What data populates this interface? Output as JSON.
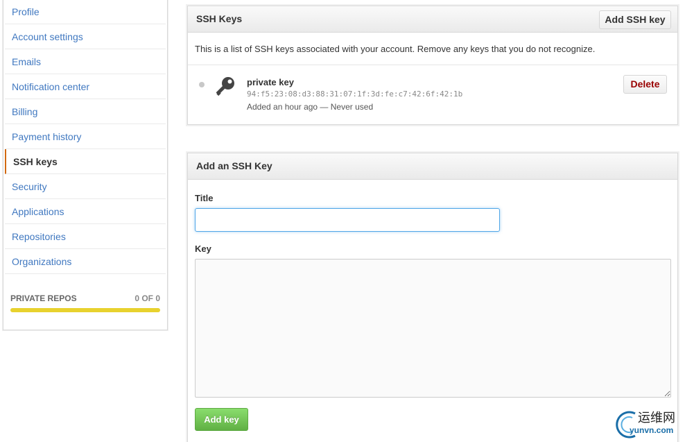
{
  "sidebar": {
    "items": [
      {
        "label": "Profile"
      },
      {
        "label": "Account settings"
      },
      {
        "label": "Emails"
      },
      {
        "label": "Notification center"
      },
      {
        "label": "Billing"
      },
      {
        "label": "Payment history"
      },
      {
        "label": "SSH keys",
        "selected": true
      },
      {
        "label": "Security"
      },
      {
        "label": "Applications"
      },
      {
        "label": "Repositories"
      },
      {
        "label": "Organizations"
      }
    ],
    "private_repos": {
      "label": "PRIVATE REPOS",
      "count": "0 OF 0",
      "progress": 1.0,
      "bar_color": "#e8d22e"
    }
  },
  "ssh_keys": {
    "title": "SSH Keys",
    "add_button": "Add SSH key",
    "notice": "This is a list of SSH keys associated with your account. Remove any keys that you do not recognize.",
    "keys": [
      {
        "name": "private key",
        "fingerprint": "94:f5:23:08:d3:88:31:07:1f:3d:fe:c7:42:6f:42:1b",
        "meta": "Added an hour ago — Never used",
        "delete_label": "Delete",
        "icon": "key-icon"
      }
    ]
  },
  "add_key": {
    "title": "Add an SSH Key",
    "title_label": "Title",
    "title_value": "",
    "key_label": "Key",
    "key_value": "",
    "submit_label": "Add key"
  },
  "watermark": {
    "cn": "运维网",
    "en": "yunvn.com"
  },
  "colors": {
    "link": "#4078c0",
    "selected_accent": "#d26911",
    "delete_text": "#990000",
    "primary_button": "#60b044",
    "focus_border": "#51a7e8"
  }
}
